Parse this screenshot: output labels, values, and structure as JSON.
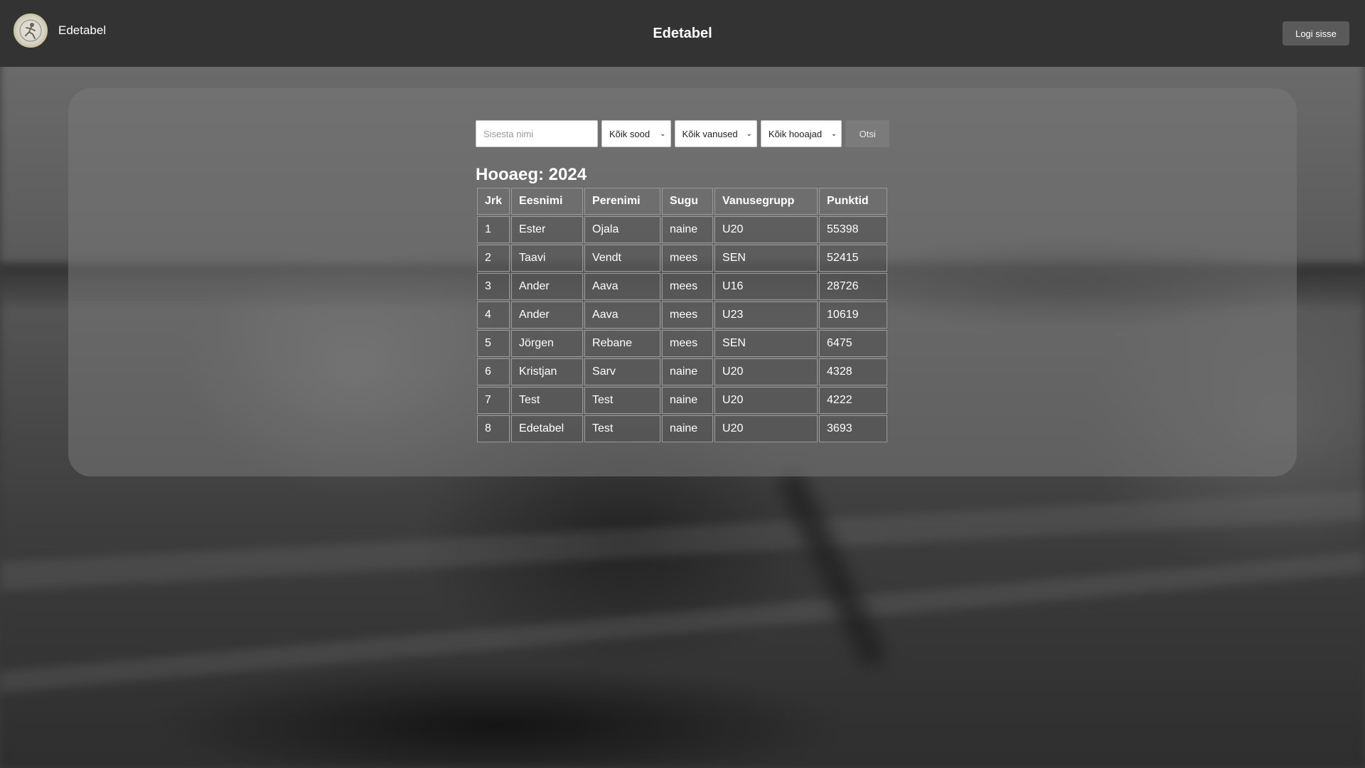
{
  "header": {
    "brand_name": "Edetabel",
    "title": "Edetabel",
    "login_label": "Logi sisse",
    "logo_icon": "athlete-logo-icon"
  },
  "filters": {
    "name_placeholder": "Sisesta nimi",
    "gender_selected": "Kõik sood",
    "age_selected": "Kõik vanused",
    "season_selected": "Kõik hooajad",
    "search_label": "Otsi"
  },
  "season": {
    "title": "Hooaeg: 2024"
  },
  "table": {
    "columns": [
      "Jrk",
      "Eesnimi",
      "Perenimi",
      "Sugu",
      "Vanusegrupp",
      "Punktid"
    ],
    "rows": [
      [
        "1",
        "Ester",
        "Ojala",
        "naine",
        "U20",
        "55398"
      ],
      [
        "2",
        "Taavi",
        "Vendt",
        "mees",
        "SEN",
        "52415"
      ],
      [
        "3",
        "Ander",
        "Aava",
        "mees",
        "U16",
        "28726"
      ],
      [
        "4",
        "Ander",
        "Aava",
        "mees",
        "U23",
        "10619"
      ],
      [
        "5",
        "Jörgen",
        "Rebane",
        "mees",
        "SEN",
        "6475"
      ],
      [
        "6",
        "Kristjan",
        "Sarv",
        "naine",
        "U20",
        "4328"
      ],
      [
        "7",
        "Test",
        "Test",
        "naine",
        "U20",
        "4222"
      ],
      [
        "8",
        "Edetabel",
        "Test",
        "naine",
        "U20",
        "3693"
      ]
    ]
  },
  "colors": {
    "header_bg": "#333333",
    "panel_bg": "#787878",
    "button_bg": "#5a5a5a",
    "search_button_bg": "#7b7b7b",
    "logo_ring": "#cfc69a"
  }
}
